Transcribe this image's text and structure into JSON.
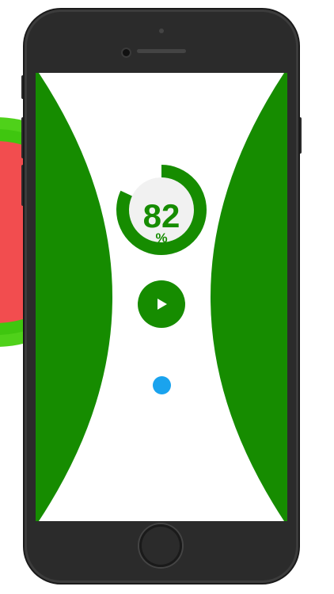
{
  "colors": {
    "wall_green": "#168c00",
    "ball_blue": "#1aa3ee",
    "ring_track": "#f1f1f1",
    "bg_bright_green": "#4fd11a",
    "bg_red": "#f24d4f"
  },
  "hud": {
    "score_value": "82",
    "score_unit": "%",
    "progress_fraction": 0.82
  },
  "controls": {
    "play_icon": "play-icon"
  },
  "device": {
    "home_button": "home-button"
  }
}
